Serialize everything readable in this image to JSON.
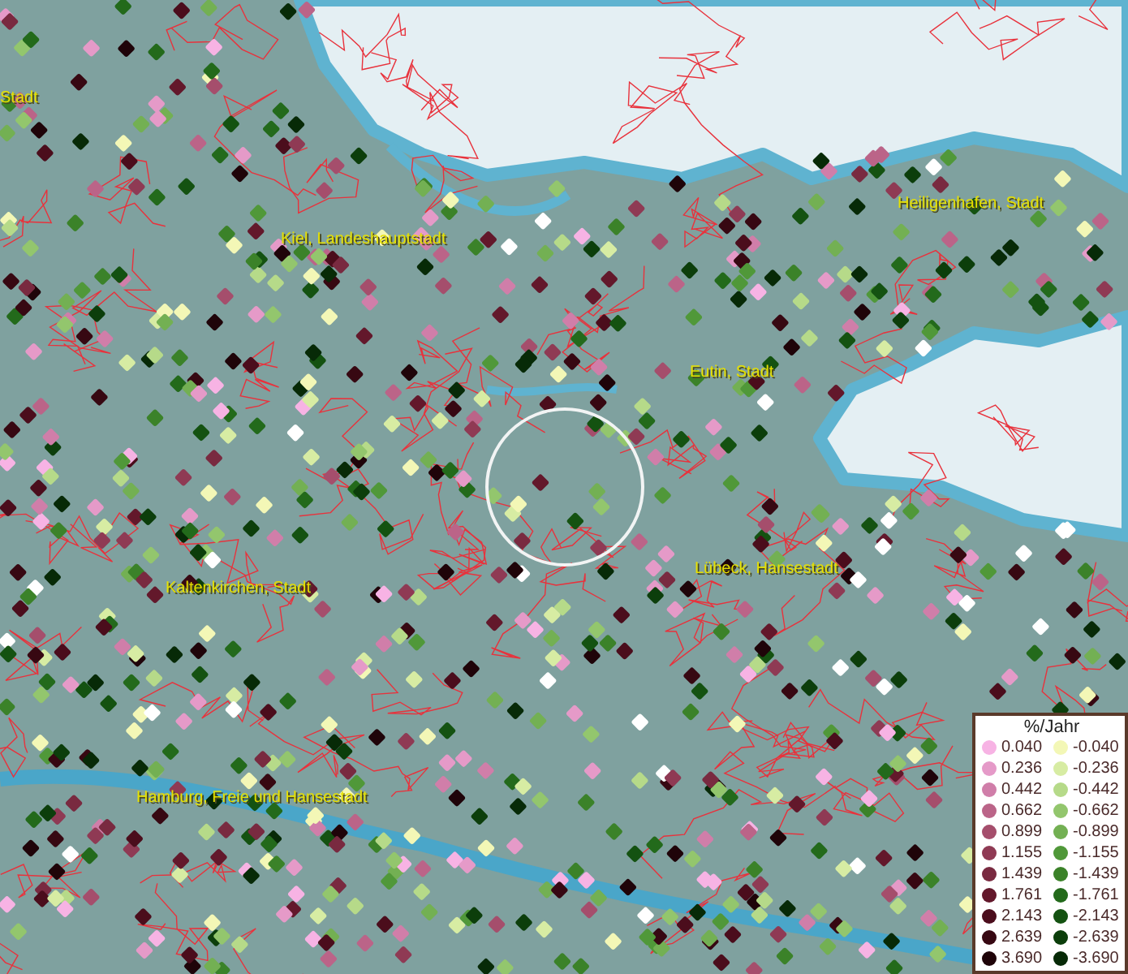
{
  "place_labels": [
    {
      "text": "Stadt"
    },
    {
      "text": "Kiel, Landeshauptstadt"
    },
    {
      "text": "Heiligenhafen, Stadt"
    },
    {
      "text": "Eutin, Stadt"
    },
    {
      "text": "Lübeck, Hansestadt"
    },
    {
      "text": "Kaltenkirchen, Stadt"
    },
    {
      "text": "Hamburg, Freie und Hansestadt"
    }
  ],
  "legend": {
    "title": "%/Jahr",
    "positive": [
      {
        "label": "0.040",
        "color": "#f7b3e4"
      },
      {
        "label": "0.236",
        "color": "#e59ac8"
      },
      {
        "label": "0.442",
        "color": "#d07ea9"
      },
      {
        "label": "0.662",
        "color": "#bb6488"
      },
      {
        "label": "0.899",
        "color": "#a54e6c"
      },
      {
        "label": "1.155",
        "color": "#8f3a54"
      },
      {
        "label": "1.439",
        "color": "#792a40"
      },
      {
        "label": "1.761",
        "color": "#63182b"
      },
      {
        "label": "2.143",
        "color": "#4b0d1c"
      },
      {
        "label": "2.639",
        "color": "#370812"
      },
      {
        "label": "3.690",
        "color": "#1f0409"
      }
    ],
    "negative": [
      {
        "label": "-0.040",
        "color": "#f3f7b6"
      },
      {
        "label": "-0.236",
        "color": "#d7eca3"
      },
      {
        "label": "-0.442",
        "color": "#b6da89"
      },
      {
        "label": "-0.662",
        "color": "#93c66d"
      },
      {
        "label": "-0.899",
        "color": "#73b053"
      },
      {
        "label": "-1.155",
        "color": "#509839"
      },
      {
        "label": "-1.439",
        "color": "#3b8229"
      },
      {
        "label": "-1.761",
        "color": "#236a1b"
      },
      {
        "label": "-2.143",
        "color": "#145211"
      },
      {
        "label": "-2.639",
        "color": "#0c3e0b"
      },
      {
        "label": "-3.690",
        "color": "#072a07"
      }
    ]
  }
}
